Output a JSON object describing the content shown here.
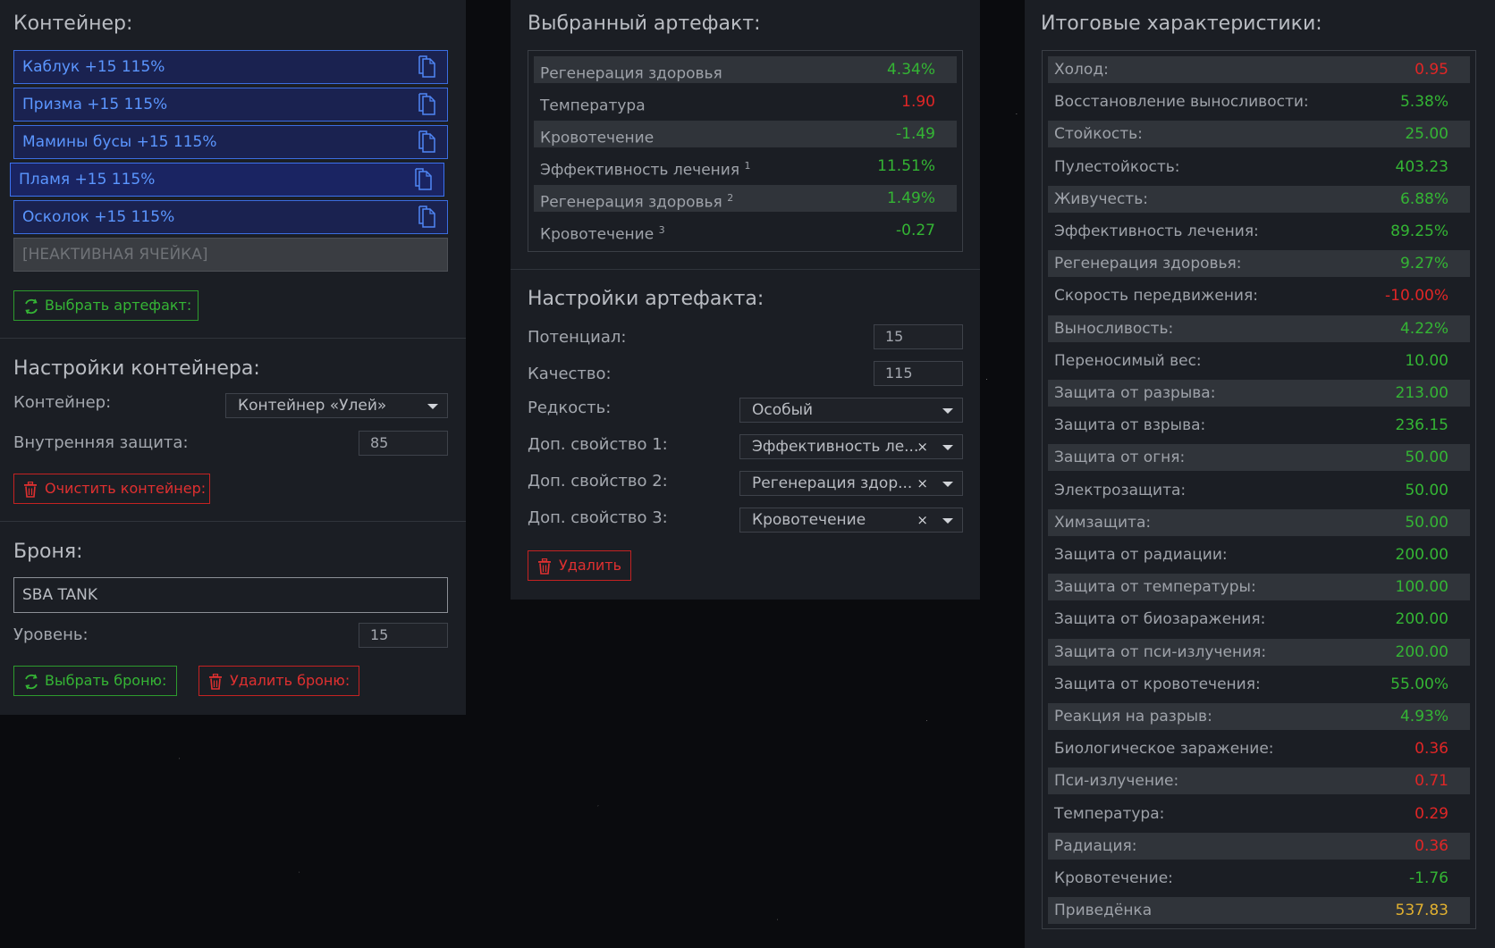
{
  "left": {
    "container_title": "Контейнер:",
    "slots": [
      {
        "label": "Каблук +15 115%"
      },
      {
        "label": "Призма +15 115%"
      },
      {
        "label": "Мамины бусы +15 115%"
      },
      {
        "label": "Пламя +15 115%",
        "selected": true
      },
      {
        "label": "Осколок +15 115%"
      }
    ],
    "inactive_slot": "[НЕАКТИВНАЯ ЯЧЕЙКА]",
    "select_artifact_button": "Выбрать артефакт:",
    "settings_title": "Настройки контейнера:",
    "container_label": "Контейнер:",
    "container_value": "Контейнер «Улей»",
    "internal_protection_label": "Внутренняя защита:",
    "internal_protection_value": "85",
    "clear_button": "Очистить контейнер:",
    "armor_title": "Броня:",
    "armor_value": "SBA TANK",
    "level_label": "Уровень:",
    "level_value": "15",
    "select_armor_button": "Выбрать броню:",
    "delete_armor_button": "Удалить броню:"
  },
  "middle": {
    "selected_title": "Выбранный артефакт:",
    "stats": [
      {
        "name": "Регенерация здоровья",
        "sup": "",
        "value": "4.34%",
        "tone": "pos"
      },
      {
        "name": "Температура",
        "sup": "",
        "value": "1.90",
        "tone": "neg"
      },
      {
        "name": "Кровотечение",
        "sup": "",
        "value": "-1.49",
        "tone": "pos"
      },
      {
        "name": "Эффективность лечения",
        "sup": "1",
        "value": "11.51%",
        "tone": "pos"
      },
      {
        "name": "Регенерация здоровья",
        "sup": "2",
        "value": "1.49%",
        "tone": "pos"
      },
      {
        "name": "Кровотечение",
        "sup": "3",
        "value": "-0.27",
        "tone": "pos"
      }
    ],
    "settings_title": "Настройки артефакта:",
    "potential_label": "Потенциал:",
    "potential_value": "15",
    "quality_label": "Качество:",
    "quality_value": "115",
    "rarity_label": "Редкость:",
    "rarity_value": "Особый",
    "extra1_label": "Доп. свойство 1:",
    "extra1_value": "Эффективность ле...",
    "extra2_label": "Доп. свойство 2:",
    "extra2_value": "Регенерация здор...",
    "extra3_label": "Доп. свойство 3:",
    "extra3_value": "Кровотечение",
    "clear_symbol": "×",
    "delete_button": "Удалить"
  },
  "right": {
    "title": "Итоговые характеристики:",
    "stats": [
      {
        "name": "Холод:",
        "value": "0.95",
        "tone": "neg"
      },
      {
        "name": "Восстановление выносливости:",
        "value": "5.38%",
        "tone": "pos"
      },
      {
        "name": "Стойкость:",
        "value": "25.00",
        "tone": "pos"
      },
      {
        "name": "Пулестойкость:",
        "value": "403.23",
        "tone": "pos"
      },
      {
        "name": "Живучесть:",
        "value": "6.88%",
        "tone": "pos"
      },
      {
        "name": "Эффективность лечения:",
        "value": "89.25%",
        "tone": "pos"
      },
      {
        "name": "Регенерация здоровья:",
        "value": "9.27%",
        "tone": "pos"
      },
      {
        "name": "Скорость передвижения:",
        "value": "-10.00%",
        "tone": "neg"
      },
      {
        "name": "Выносливость:",
        "value": "4.22%",
        "tone": "pos"
      },
      {
        "name": "Переносимый вес:",
        "value": "10.00",
        "tone": "pos"
      },
      {
        "name": "Защита от разрыва:",
        "value": "213.00",
        "tone": "pos"
      },
      {
        "name": "Защита от взрыва:",
        "value": "236.15",
        "tone": "pos"
      },
      {
        "name": "Защита от огня:",
        "value": "50.00",
        "tone": "pos"
      },
      {
        "name": "Электрозащита:",
        "value": "50.00",
        "tone": "pos"
      },
      {
        "name": "Химзащита:",
        "value": "50.00",
        "tone": "pos"
      },
      {
        "name": "Защита от радиации:",
        "value": "200.00",
        "tone": "pos"
      },
      {
        "name": "Защита от температуры:",
        "value": "100.00",
        "tone": "pos"
      },
      {
        "name": "Защита от биозаражения:",
        "value": "200.00",
        "tone": "pos"
      },
      {
        "name": "Защита от пси-излучения:",
        "value": "200.00",
        "tone": "pos"
      },
      {
        "name": "Защита от кровотечения:",
        "value": "55.00%",
        "tone": "pos"
      },
      {
        "name": "Реакция на разрыв:",
        "value": "4.93%",
        "tone": "pos"
      },
      {
        "name": "Биологическое заражение:",
        "value": "0.36",
        "tone": "neg"
      },
      {
        "name": "Пси-излучение:",
        "value": "0.71",
        "tone": "neg"
      },
      {
        "name": "Температура:",
        "value": "0.29",
        "tone": "neg"
      },
      {
        "name": "Радиация:",
        "value": "0.36",
        "tone": "neg"
      },
      {
        "name": "Кровотечение:",
        "value": "-1.76",
        "tone": "pos"
      },
      {
        "name": "Приведёнка",
        "value": "537.83",
        "tone": "gold"
      }
    ]
  }
}
